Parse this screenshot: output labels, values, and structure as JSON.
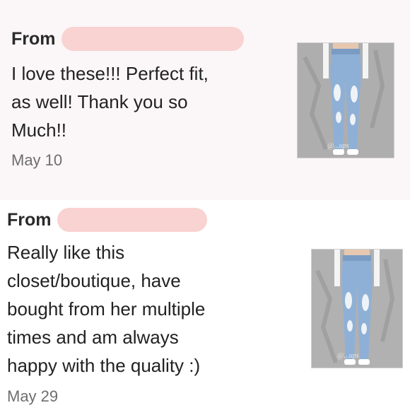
{
  "reviews": [
    {
      "from_label": "From",
      "reviewer_name_redacted": true,
      "text_lines": [
        "I love these!!! Perfect fit,",
        "as well! Thank you so",
        "Much!!"
      ],
      "date": "May 10",
      "product_image": {
        "icon": "jeans-photo",
        "watermark": "@...ups"
      }
    },
    {
      "from_label": "From",
      "reviewer_name_redacted": true,
      "text_lines": [
        "Really like this",
        "closet/boutique, have",
        "bought from her multiple",
        "times and am always",
        "happy with the quality :)"
      ],
      "date": "May 29",
      "product_image": {
        "icon": "jeans-photo",
        "watermark": "@...ups"
      }
    }
  ],
  "colors": {
    "highlight_background": "#fbf6f7",
    "redaction": "#f9d2d2",
    "denim": "#8fb0d6",
    "date_text": "#6e6e6e"
  }
}
